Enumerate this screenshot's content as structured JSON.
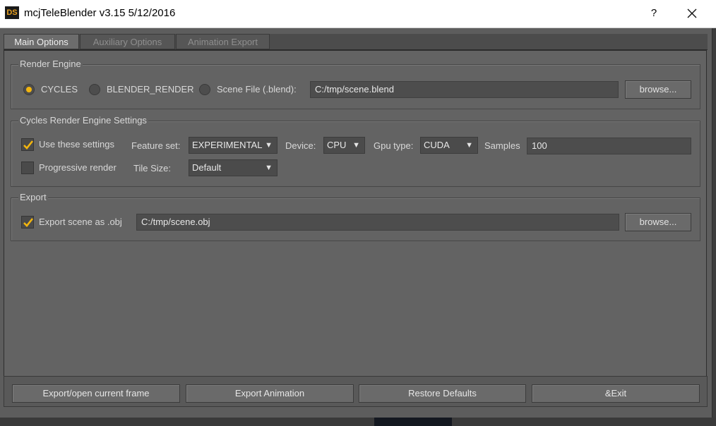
{
  "window": {
    "title": "mcjTeleBlender v3.15 5/12/2016",
    "icon_text": "DS",
    "help": "?",
    "close": "✕"
  },
  "tabs": [
    {
      "label": "Main Options",
      "active": true
    },
    {
      "label": "Auxiliary Options",
      "active": false
    },
    {
      "label": "Animation Export",
      "active": false
    }
  ],
  "render_engine": {
    "title": "Render Engine",
    "options": [
      {
        "label": "CYCLES",
        "selected": true
      },
      {
        "label": "BLENDER_RENDER",
        "selected": false
      },
      {
        "label": "Scene File (.blend):",
        "selected": false
      }
    ],
    "scene_file": "C:/tmp/scene.blend",
    "browse_label": "browse..."
  },
  "cycles": {
    "title": "Cycles Render Engine Settings",
    "use_settings_label": "Use these settings",
    "use_settings_checked": true,
    "feature_set_label": "Feature set:",
    "feature_set_value": "EXPERIMENTAL",
    "device_label": "Device:",
    "device_value": "CPU",
    "gpu_type_label": "Gpu type:",
    "gpu_type_value": "CUDA",
    "samples_label": "Samples",
    "samples_value": "100",
    "progressive_label": "Progressive render",
    "progressive_checked": false,
    "tile_size_label": "Tile Size:",
    "tile_size_value": "Default"
  },
  "export": {
    "title": "Export",
    "export_obj_label": "Export scene as .obj",
    "export_obj_checked": true,
    "obj_path": "C:/tmp/scene.obj",
    "browse_label": "browse..."
  },
  "bottom_buttons": {
    "export_frame": "Export/open current frame",
    "export_animation": "Export Animation",
    "restore_defaults": "Restore Defaults",
    "exit": "&Exit"
  },
  "colors": {
    "accent": "#f2b50f",
    "panel": "#636363",
    "field": "#4d4d4d"
  },
  "arrow_glyph": "▼"
}
